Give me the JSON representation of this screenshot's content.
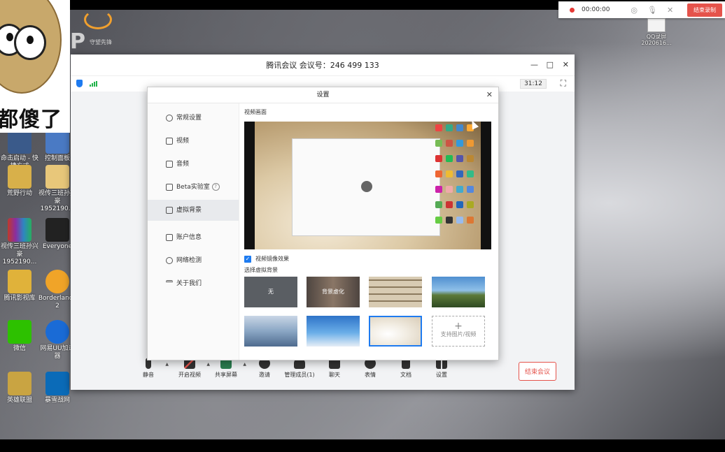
{
  "overlay": {
    "caption": "都傻了"
  },
  "watermark": {
    "logo": "P",
    "tag": "守望先锋"
  },
  "recorder": {
    "time": "00:00:00",
    "stop_label": "结束录制"
  },
  "desktop_right": {
    "label": "QQ录屏",
    "sub": "2020616..."
  },
  "desktop_icons": [
    {
      "label": "命击启动 - 快捷方式",
      "color": "#3a5a8a"
    },
    {
      "label": "控制面板",
      "color": "#4a7ac4"
    },
    {
      "label": "荒野行动",
      "color": "#d8b04a"
    },
    {
      "label": "视传三班孙兴豪1952190...",
      "color": "#e8c77a"
    },
    {
      "label": "视传三班孙兴豪1952190...",
      "color": "#8a2ea0"
    },
    {
      "label": "Everyone",
      "color": "#222222"
    },
    {
      "label": "腾讯影视库",
      "color": "#e0b23a"
    },
    {
      "label": "Borderlands 2",
      "color": "#f0a428"
    },
    {
      "label": "微信",
      "color": "#2dc100"
    },
    {
      "label": "网易UU加速器",
      "color": "#1a6bd6"
    },
    {
      "label": "英雄联盟",
      "color": "#c9a442"
    },
    {
      "label": "暴雪战网",
      "color": "#0b6bb8"
    }
  ],
  "meeting": {
    "title": "腾讯会议 会议号：246 499 133",
    "timer": "31:12",
    "window_min": "—",
    "window_max": "□",
    "window_close": "✕",
    "toolbar": [
      {
        "label": "静音",
        "icon": "microphone-icon"
      },
      {
        "label": "开启视频",
        "icon": "video-off-icon"
      },
      {
        "label": "共享屏幕",
        "icon": "share-screen-icon"
      },
      {
        "label": "邀请",
        "icon": "invite-icon"
      },
      {
        "label": "管理成员(1)",
        "icon": "members-icon"
      },
      {
        "label": "聊天",
        "icon": "chat-icon"
      },
      {
        "label": "表情",
        "icon": "emoji-icon"
      },
      {
        "label": "文档",
        "icon": "document-icon"
      },
      {
        "label": "设置",
        "icon": "settings-icon"
      }
    ],
    "end_label": "结束会议"
  },
  "settings": {
    "title": "设置",
    "close": "✕",
    "nav": [
      {
        "label": "常规设置",
        "icon": "gear-icon"
      },
      {
        "label": "视频",
        "icon": "camera-icon"
      },
      {
        "label": "音频",
        "icon": "speaker-icon"
      },
      {
        "label": "Beta实验室",
        "icon": "lab-icon",
        "help": "?"
      },
      {
        "label": "虚拟背景",
        "icon": "background-icon",
        "active": true
      },
      {
        "label": "账户信息",
        "icon": "account-icon"
      },
      {
        "label": "网络检测",
        "icon": "network-icon"
      },
      {
        "label": "关于我们",
        "icon": "about-icon"
      }
    ],
    "preview_label": "视频画面",
    "mirror_label": "视频镜像效果",
    "mirror_checked": true,
    "choose_label": "选择虚拟背景",
    "backgrounds": [
      {
        "label": "无",
        "color": "#5a5e63"
      },
      {
        "label": "背景虚化",
        "color": "#6d6259"
      },
      {
        "label": "",
        "color": "#b9a58a"
      },
      {
        "label": "",
        "color": "#4f8fd0"
      },
      {
        "label": "",
        "color": "#8aa6c4"
      },
      {
        "label": "",
        "color": "#3f86d8"
      },
      {
        "label": "",
        "color": "#e8dfcf",
        "selected": true
      },
      {
        "label": "支持图片/视频",
        "add": true,
        "plus": "+"
      }
    ]
  }
}
